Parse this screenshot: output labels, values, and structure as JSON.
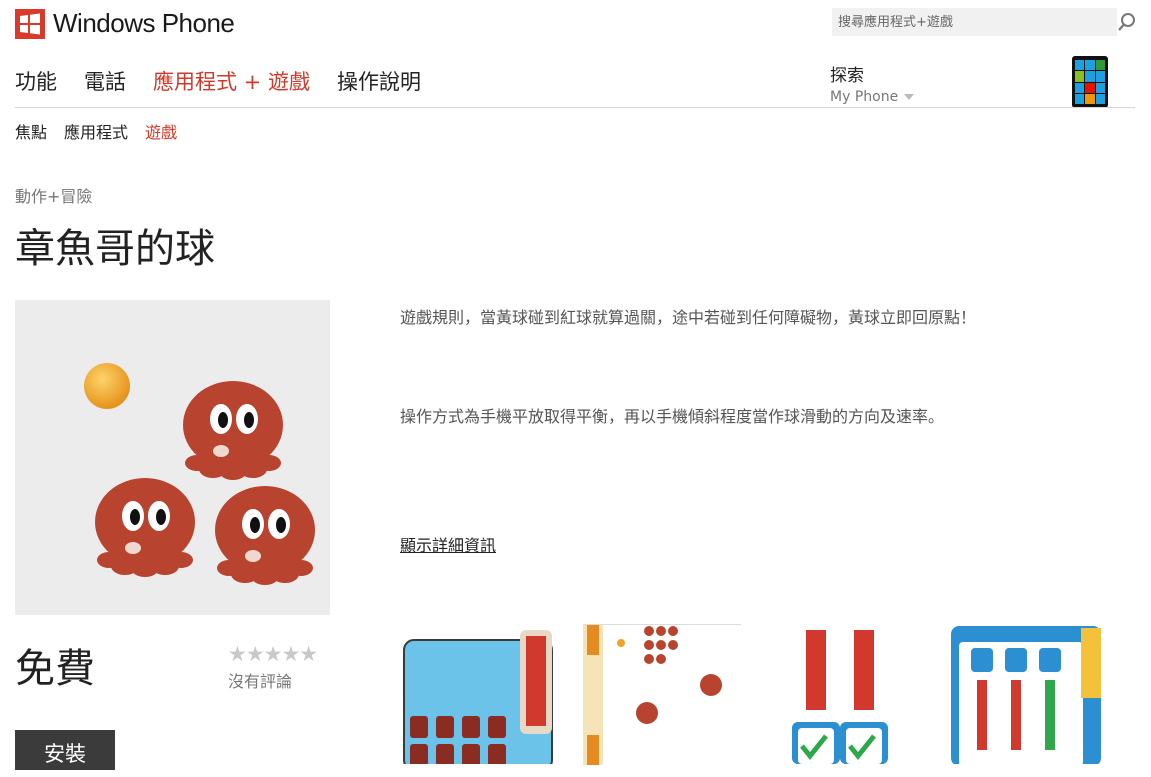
{
  "header": {
    "brand": "Windows Phone",
    "search_placeholder": "搜尋應用程式+遊戲"
  },
  "nav": {
    "main": [
      "功能",
      "電話",
      "應用程式 + 遊戲",
      "操作說明"
    ],
    "active_main": 2,
    "explore_label": "探索",
    "explore_sub": "My Phone",
    "sub": [
      "焦點",
      "應用程式",
      "遊戲"
    ],
    "active_sub": 2
  },
  "app": {
    "category": "動作+冒險",
    "title": "章魚哥的球",
    "price": "免費",
    "rating_stars": "★★★★★",
    "rating_value": 0,
    "review_text": "沒有評論",
    "install_label": "安裝",
    "description": [
      "遊戲規則，當黃球碰到紅球就算過關，途中若碰到任何障礙物，黃球立即回原點！",
      "操作方式為手機平放取得平衡，再以手機傾斜程度當作球滑動的方向及速率。"
    ],
    "details_link": "顯示詳細資訊"
  },
  "colors": {
    "accent": "#d03a2b",
    "octopus": "#b8432f",
    "ball": "#f0a22a",
    "install_bg": "#3b3b3b"
  }
}
